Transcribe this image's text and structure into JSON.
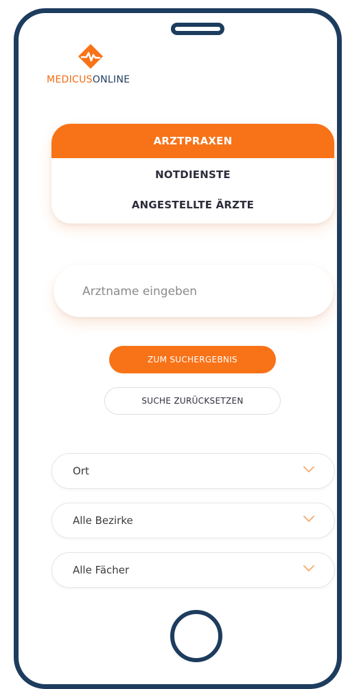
{
  "brand": {
    "name_part1": "MEDICUS",
    "name_part2": "ONLINE",
    "logo_icon": "medicus-diamond-logo"
  },
  "colors": {
    "accent": "#f87217",
    "frame": "#1d3c5e",
    "text": "#2c2c3a"
  },
  "search_mode": {
    "options": [
      {
        "label": "ARZTPRAXEN",
        "active": true
      },
      {
        "label": "NOTDIENSTE",
        "active": false
      },
      {
        "label": "ANGESTELLTE ÄRZTE",
        "active": false
      }
    ]
  },
  "search": {
    "placeholder": "Arztname eingeben",
    "value": ""
  },
  "actions": {
    "submit_label": "ZUM SUCHERGEBNIS",
    "reset_label": "SUCHE ZURÜCKSETZEN"
  },
  "filters": [
    {
      "label": "Ort",
      "icon": "chevron-down-icon"
    },
    {
      "label": "Alle Bezirke",
      "icon": "chevron-down-icon"
    },
    {
      "label": "Alle Fächer",
      "icon": "chevron-down-icon"
    }
  ]
}
